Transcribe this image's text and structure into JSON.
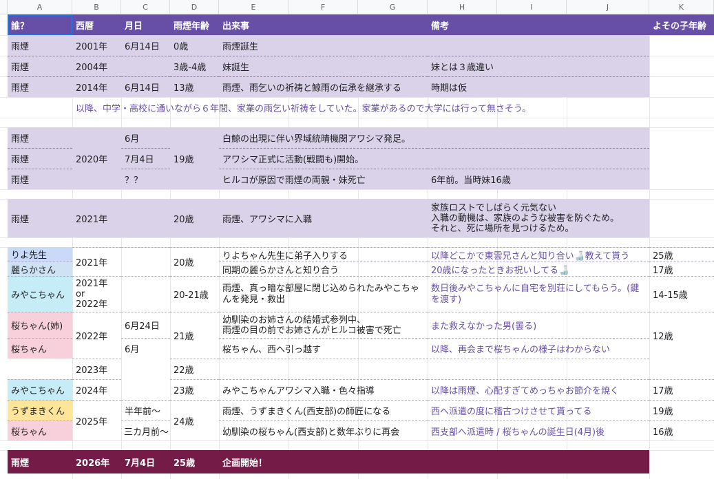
{
  "columns": [
    "A",
    "B",
    "C",
    "D",
    "E",
    "F",
    "G",
    "H",
    "I",
    "J",
    "K"
  ],
  "header": {
    "who": "誰？",
    "year": "西暦",
    "date": "月日",
    "age": "雨煙年齢",
    "event": "出来事",
    "note": "備考",
    "other_age": "よその子年齢"
  },
  "rows": {
    "r1": {
      "who": "雨煙",
      "year": "2001年",
      "date": "6月14日",
      "age": "0歳",
      "event": "雨煙誕生"
    },
    "r2": {
      "who": "雨煙",
      "year": "2004年",
      "age": "3歳-4歳",
      "event": "妹誕生",
      "note": "妹とは３歳違い"
    },
    "r3": {
      "who": "雨煙",
      "year": "2014年",
      "date": "6月14日",
      "age": "13歳",
      "event": "雨煙、雨乞いの祈祷と鯨雨の伝承を継承する",
      "note": "時期は仮"
    },
    "r4": {
      "text": "以降、中学・高校に通いながら６年間、家業の雨乞い祈祷をしていた。家業があるので大学には行って無さそう。"
    },
    "r5": {
      "who1": "雨煙",
      "who2": "雨煙",
      "who3": "雨煙",
      "year": "2020年",
      "date1": "6月",
      "date2": "7月4日",
      "date3": "？？",
      "age": "19歳",
      "event1": "白鯨の出現に伴い界域統晴機関アワシマ発足。",
      "event2": "アワシマ正式に活動(戦闘も)開始。",
      "event3": "ヒルコが原因で雨煙の両親・妹死亡",
      "note3": "6年前。当時妹16歳"
    },
    "r6": {
      "who": "雨煙",
      "year": "2021年",
      "age": "20歳",
      "event": "雨煙、アワシマに入職",
      "note": "家族ロストでしばらく元気ない\n入職の動機は、家族のような被害を防ぐため。\nそれと、死に場所を見つけるため。"
    },
    "r7": {
      "who1": "りよ先生",
      "who2": "麗らかさん",
      "year": "2021年",
      "age": "20歳",
      "event1": "りよちゃん先生に弟子入りする",
      "event2": "同期の麗らかさんと知り合う",
      "note1": "以降どこかで東雲兄さんと知り合い🍶教えて貰う",
      "note2": "20歳になったときお祝いしてる🍶",
      "k1": "25歳",
      "k2": "17歳"
    },
    "r8": {
      "who": "みやこちゃん",
      "year": "2021年\nor\n2022年",
      "age": "20-21歳",
      "event": "雨煙、真っ暗な部屋に閉じ込められたみやこちゃんを発見・救出",
      "note": "数日後みやこちゃんに自宅を別荘にしてもらう。(鍵を渡す)",
      "k": "14-15歳"
    },
    "r9": {
      "who1": "桜ちゃん(姉)",
      "who2": "桜ちゃん",
      "year": "2022年",
      "date1": "6月24日",
      "date2": "6月",
      "age": "21歳",
      "event1": "幼馴染のお姉さんの結婚式参列中、\n雨煙の目の前でお姉さんがヒルコ被害で死亡",
      "event2": "桜ちゃん、西へ引っ越す",
      "note1": "また救えなかった男(曇る)",
      "note2": "以降、再会まで桜ちゃんの様子はわからない",
      "k": "12歳"
    },
    "r10": {
      "year": "2023年",
      "age": "22歳"
    },
    "r11": {
      "who": "みやこちゃん",
      "year": "2024年",
      "age": "23歳",
      "event": "みやこちゃんアワシマ入職・色々指導",
      "note": "以降は雨煙、心配すぎてめっちゃお節介を焼く",
      "k": "17歳"
    },
    "r12": {
      "who1": "うずまきくん",
      "who2": "桜ちゃん",
      "year": "2025年",
      "date1": "半年前～",
      "date2": "三カ月前～",
      "age": "24歳",
      "event1": "雨煙、うずまきくん(西支部)の師匠になる",
      "event2": "幼馴染の桜ちゃん(西支部)と数年ぶりに再会",
      "note1": "西へ派遣の度に稽古つけさせて貰ってる",
      "note2": "西支部へ派遣時 / 桜ちゃんの誕生日(4月)後",
      "k1": "19歳",
      "k2": "16歳"
    },
    "r13": {
      "who": "雨煙",
      "year": "2026年",
      "date": "7月4日",
      "age": "25歳",
      "event": "企画開始！"
    }
  },
  "colors": {
    "header": "#674ea7",
    "lavender": "#d9d2e9",
    "final_row": "#741b47"
  }
}
